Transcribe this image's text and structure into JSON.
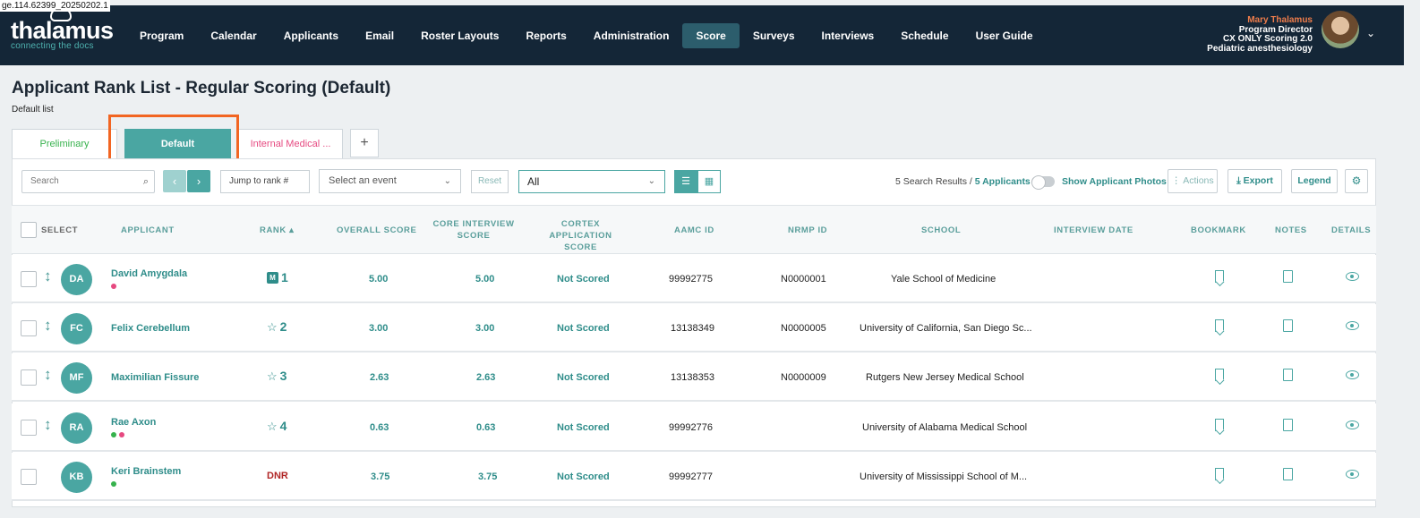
{
  "build": "ge.114.62399_20250202.1",
  "brand": {
    "name": "thalamus",
    "tagline": "connecting the docs"
  },
  "nav": [
    "Program",
    "Calendar",
    "Applicants",
    "Email",
    "Roster Layouts",
    "Reports",
    "Administration",
    "Score",
    "Surveys",
    "Interviews",
    "Schedule",
    "User Guide"
  ],
  "nav_active": "Score",
  "user": {
    "name": "Mary Thalamus",
    "role": "Program Director",
    "org": "CX ONLY Scoring 2.0",
    "program": "Pediatric anesthesiology"
  },
  "page": {
    "title": "Applicant Rank List - Regular Scoring (Default)",
    "subtitle": "Default list"
  },
  "tabs": {
    "preliminary": "Preliminary",
    "default": "Default",
    "internal": "Internal Medical ...",
    "add": "+"
  },
  "toolbar": {
    "search_placeholder": "Search",
    "jump_placeholder": "Jump to rank #",
    "event_placeholder": "Select an event",
    "reset": "Reset",
    "filter_value": "All",
    "results_count": "5 Search Results",
    "results_sep": " / ",
    "results_applicants": "5 Applicants",
    "show_photos": "Show Applicant Photos",
    "actions": "⋮ Actions",
    "export": "Export",
    "legend": "Legend"
  },
  "columns": {
    "select": "SELECT",
    "applicant": "APPLICANT",
    "rank": "RANK",
    "overall": "OVERALL SCORE",
    "core1": "CORE INTERVIEW",
    "core2": "SCORE",
    "cortex1": "CORTEX APPLICATION",
    "cortex2": "SCORE",
    "aamc": "AAMC ID",
    "nrmp": "NRMP ID",
    "school": "SCHOOL",
    "interview": "INTERVIEW DATE",
    "bookmark": "BOOKMARK",
    "notes": "NOTES",
    "details": "DETAILS"
  },
  "rows": [
    {
      "initials": "DA",
      "name": "David Amygdala",
      "rank": "1",
      "overall": "5.00",
      "core": "5.00",
      "cortex": "Not Scored",
      "aamc": "99992775",
      "nrmp": "N0000001",
      "school": "Yale School of Medicine"
    },
    {
      "initials": "FC",
      "name": "Felix Cerebellum",
      "rank": "2",
      "overall": "3.00",
      "core": "3.00",
      "cortex": "Not Scored",
      "aamc": "13138349",
      "nrmp": "N0000005",
      "school": "University of California, San Diego Sc..."
    },
    {
      "initials": "MF",
      "name": "Maximilian Fissure",
      "rank": "3",
      "overall": "2.63",
      "core": "2.63",
      "cortex": "Not Scored",
      "aamc": "13138353",
      "nrmp": "N0000009",
      "school": "Rutgers New Jersey Medical School"
    },
    {
      "initials": "RA",
      "name": "Rae Axon",
      "rank": "4",
      "overall": "0.63",
      "core": "0.63",
      "cortex": "Not Scored",
      "aamc": "99992776",
      "nrmp": "",
      "school": "University of Alabama Medical School"
    },
    {
      "initials": "KB",
      "name": "Keri Brainstem",
      "rank": "DNR",
      "overall": "3.75",
      "core": "3.75",
      "cortex": "Not Scored",
      "aamc": "99992777",
      "nrmp": "",
      "school": "University of Mississippi School of M..."
    }
  ],
  "colors": {
    "navy": "#142637",
    "teal": "#4aa6a2",
    "highlight": "#f26522",
    "pink": "#e64980",
    "green": "#37b24d",
    "dnr": "#b02525"
  }
}
